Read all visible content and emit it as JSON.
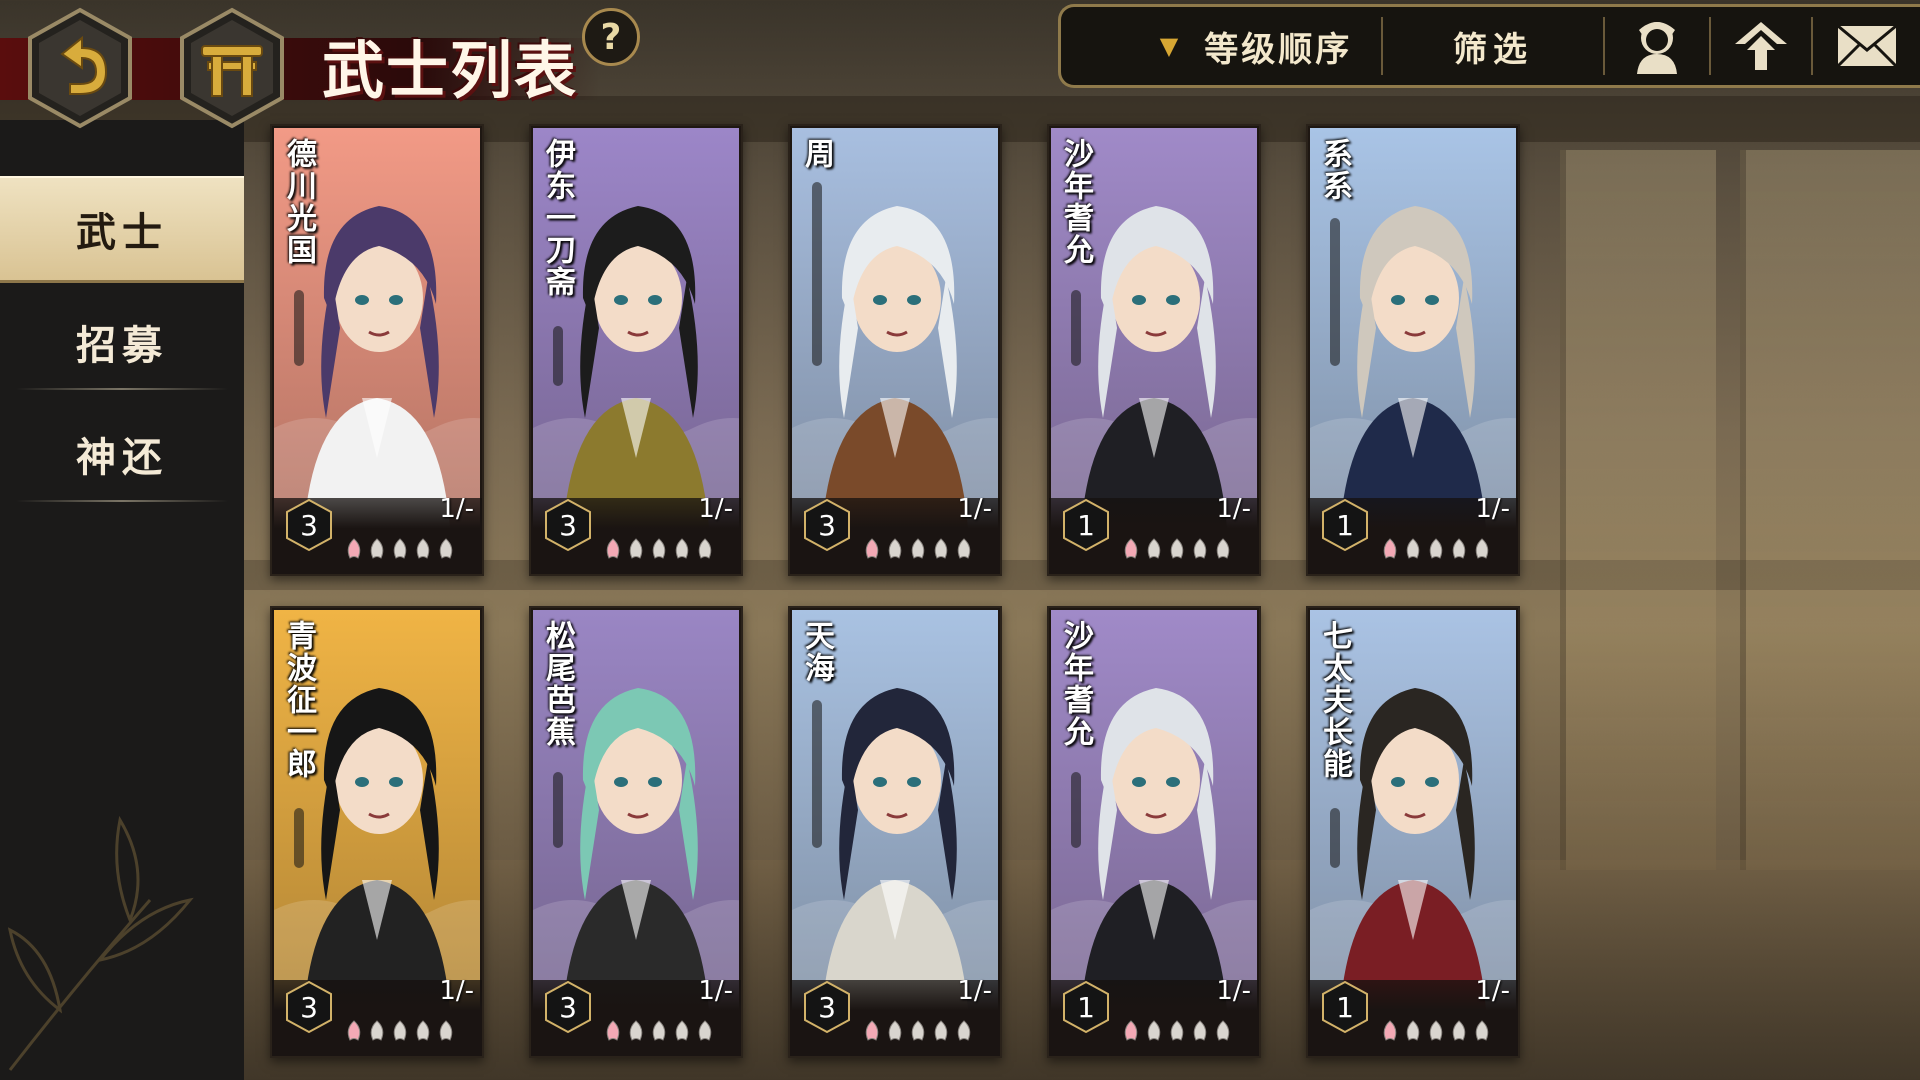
{
  "header": {
    "title": "武士列表",
    "help_label": "?",
    "sort_label": "等级顺序",
    "filter_label": "筛选"
  },
  "sidebar": {
    "items": [
      {
        "label": "武士",
        "active": true
      },
      {
        "label": "招募",
        "active": false
      },
      {
        "label": "神还",
        "active": false
      }
    ]
  },
  "colors": {
    "accent_gold": "#a8894e",
    "title_red": "#5b1010",
    "active_tab": "#e6d5a9"
  },
  "cards": [
    {
      "name": "德川光国",
      "rank": "3",
      "count": "1/-",
      "bg": "#f29a86",
      "hair": "#4b3a6a",
      "robe": "#f2f2f2",
      "filled_petals": 1
    },
    {
      "name": "伊东一刀斋",
      "rank": "3",
      "count": "1/-",
      "bg": "#9c86c8",
      "hair": "#1c1c1c",
      "robe": "#8c7a2e",
      "filled_petals": 1
    },
    {
      "name": "周",
      "rank": "3",
      "count": "1/-",
      "bg": "#a8bfe0",
      "hair": "#e8ecef",
      "robe": "#7a4a2a",
      "filled_petals": 1
    },
    {
      "name": "沙年耆允",
      "rank": "1",
      "count": "1/-",
      "bg": "#a08ac8",
      "hair": "#dfe3e8",
      "robe": "#1f1f24",
      "filled_petals": 1
    },
    {
      "name": "系系",
      "rank": "1",
      "count": "1/-",
      "bg": "#a9c4e6",
      "hair": "#cfc8bd",
      "robe": "#1f2a4a",
      "filled_petals": 1
    },
    {
      "name": "青波征一郎",
      "rank": "3",
      "count": "1/-",
      "bg": "#f0b445",
      "hair": "#161616",
      "robe": "#222222",
      "filled_petals": 1
    },
    {
      "name": "松尾芭蕉",
      "rank": "3",
      "count": "1/-",
      "bg": "#9a86c4",
      "hair": "#7cc8b4",
      "robe": "#2a2a2a",
      "filled_petals": 1
    },
    {
      "name": "天海",
      "rank": "3",
      "count": "1/-",
      "bg": "#a9c2e2",
      "hair": "#22263a",
      "robe": "#d9d6cc",
      "filled_petals": 1
    },
    {
      "name": "沙年耆允",
      "rank": "1",
      "count": "1/-",
      "bg": "#a08ac8",
      "hair": "#dfe3e8",
      "robe": "#1f1f24",
      "filled_petals": 1
    },
    {
      "name": "七太夫长能",
      "rank": "1",
      "count": "1/-",
      "bg": "#aac3e4",
      "hair": "#2a2622",
      "robe": "#7a1e24",
      "filled_petals": 1
    }
  ]
}
